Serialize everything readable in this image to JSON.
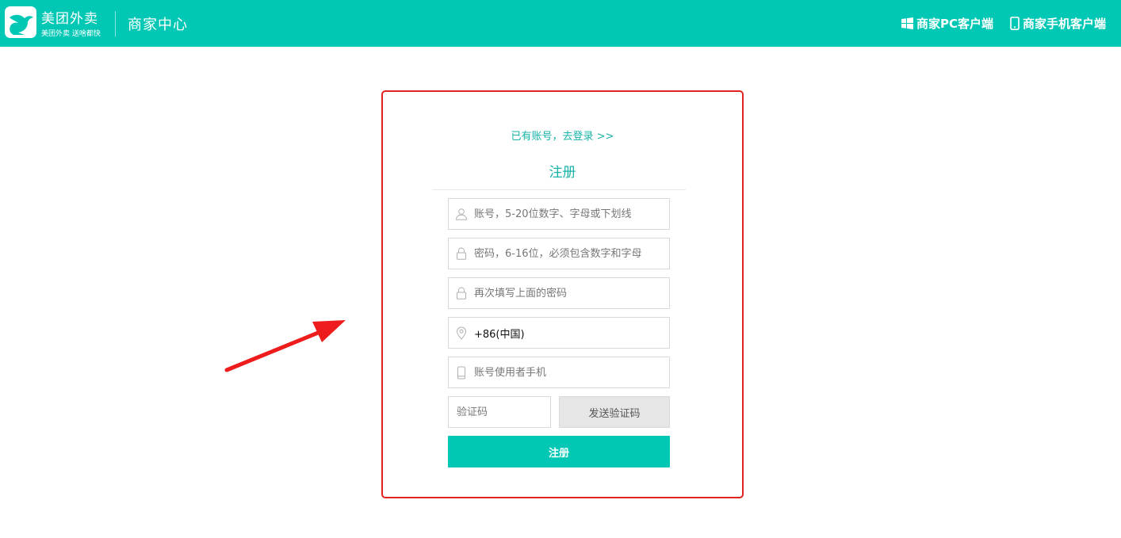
{
  "header": {
    "brand_name": "美团外卖",
    "brand_slogan": "美团外卖  送啥都快",
    "center_title": "商家中心",
    "pc_client_label": "商家PC客户端",
    "mobile_client_label": "商家手机客户端",
    "background_color": "#00c8b5",
    "icons": {
      "logo": "kangaroo-logo-icon",
      "pc_client": "windows-icon",
      "mobile_client": "phone-icon"
    }
  },
  "form": {
    "login_link": "已有账号，去登录 >>",
    "title": "注册",
    "account_placeholder": "账号，5-20位数字、字母或下划线",
    "password_placeholder": "密码，6-16位，必须包含数字和字母",
    "confirm_placeholder": "再次填写上面的密码",
    "region_value": "+86(中国)",
    "phone_placeholder": "账号使用者手机",
    "code_placeholder": "验证码",
    "send_code_label": "发送验证码",
    "submit_label": "注册",
    "accent_color": "#16b3a6",
    "highlight_border_color": "#e2231f",
    "icons": {
      "account": "user-icon",
      "password": "lock-icon",
      "confirm": "lock-icon",
      "region": "location-pin-icon",
      "phone": "phone-icon"
    }
  },
  "annotation": {
    "arrow_color": "#ee1c1c",
    "arrow_icon": "arrow-icon"
  }
}
